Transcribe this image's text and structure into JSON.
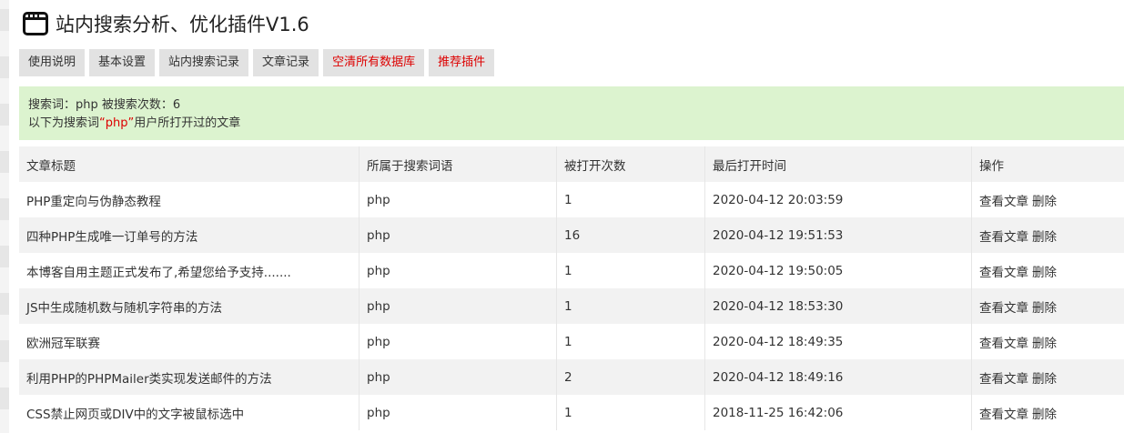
{
  "header": {
    "title": "站内搜索分析、优化插件V1.6",
    "icon": "window-icon"
  },
  "tabs": [
    {
      "label": "使用说明",
      "color": "#333333"
    },
    {
      "label": "基本设置",
      "color": "#333333"
    },
    {
      "label": "站内搜索记录",
      "color": "#333333"
    },
    {
      "label": "文章记录",
      "color": "#333333"
    },
    {
      "label": "空清所有数据库",
      "color": "#dd0000"
    },
    {
      "label": "推荐插件",
      "color": "#dd0000"
    }
  ],
  "notice": {
    "line1": "搜索词：php  被搜索次数：6",
    "line2_prefix": "以下为搜索词",
    "keyword": "“php”",
    "line2_suffix": "用户所打开过的文章",
    "background": "#dcf3cf"
  },
  "table": {
    "headers": [
      "文章标题",
      "所属于搜索词语",
      "被打开次数",
      "最后打开时间",
      "操作"
    ],
    "rows": [
      {
        "title": "PHP重定向与伪静态教程",
        "keyword": "php",
        "count": "1",
        "time": "2020-04-12 20:03:59",
        "view": "查看文章",
        "delete": "删除"
      },
      {
        "title": "四种PHP生成唯一订单号的方法",
        "keyword": "php",
        "count": "16",
        "time": "2020-04-12 19:51:53",
        "view": "查看文章",
        "delete": "删除"
      },
      {
        "title": "本博客自用主题正式发布了,希望您给予支持.......",
        "keyword": "php",
        "count": "1",
        "time": "2020-04-12 19:50:05",
        "view": "查看文章",
        "delete": "删除"
      },
      {
        "title": "JS中生成随机数与随机字符串的方法",
        "keyword": "php",
        "count": "1",
        "time": "2020-04-12 18:53:30",
        "view": "查看文章",
        "delete": "删除"
      },
      {
        "title": "欧洲冠军联赛",
        "keyword": "php",
        "count": "1",
        "time": "2020-04-12 18:49:35",
        "view": "查看文章",
        "delete": "删除"
      },
      {
        "title": "利用PHP的PHPMailer类实现发送邮件的方法",
        "keyword": "php",
        "count": "2",
        "time": "2020-04-12 18:49:16",
        "view": "查看文章",
        "delete": "删除"
      },
      {
        "title": "CSS禁止网页或DIV中的文字被鼠标选中",
        "keyword": "php",
        "count": "1",
        "time": "2018-11-25 16:42:06",
        "view": "查看文章",
        "delete": "删除"
      }
    ]
  }
}
